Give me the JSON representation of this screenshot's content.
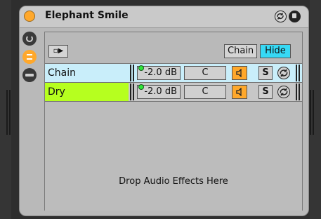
{
  "device": {
    "title": "Elephant Smile",
    "power_icon": "power-icon",
    "hotswap_icon": "hotswap-icon",
    "save_icon": "save-preset-icon"
  },
  "left_buttons": [
    {
      "icon": "macro-knob-icon"
    },
    {
      "icon": "chain-list-icon"
    },
    {
      "icon": "devices-icon"
    }
  ],
  "toolbar": {
    "sequencer_glyph": "▫▶",
    "chain_label": "Chain",
    "hide_label": "Hide"
  },
  "chains": [
    {
      "name": "Chain",
      "volume": "-2.0 dB",
      "pan": "C",
      "solo": "S",
      "color": "#c9eefa"
    },
    {
      "name": "Dry",
      "volume": "-2.0 dB",
      "pan": "C",
      "solo": "S",
      "color": "#b6ff1f"
    }
  ],
  "drop_text": "Drop Audio Effects Here",
  "colors": {
    "accent_orange": "#ffa82b",
    "hide_active": "#36d9f5",
    "dry_chain": "#b6ff1f",
    "selected_chain": "#c9eefa"
  }
}
